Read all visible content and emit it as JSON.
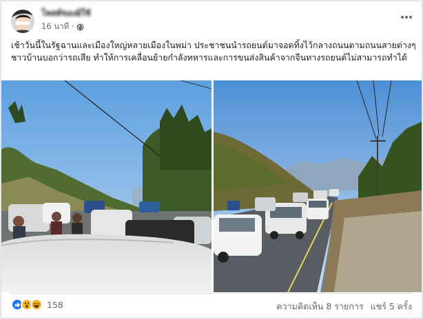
{
  "post": {
    "author_name": "โพสต์ของผู้ใช้",
    "timestamp": "16 นาที ·",
    "privacy_icon": "globe-icon",
    "more_icon": "more-options-icon",
    "caption": "เช้าวันนี้ในรัฐฉานและเมืองใหญ่หลายเมืองในพม่า ประชาชนนำรถยนต์มาจอดทิ้งไว้กลางถนนตามถนนสายต่างๆ ชาวบ้านบอกว่ารถเสีย ทำให้การเคลื่อนย้ายกำลังทหารและการขนส่งสินค้าจากจีนทางรถยนต์ไม่สามารถทำได้"
  },
  "photos": [
    {
      "name": "photo-cars-parked-left"
    },
    {
      "name": "photo-cars-road-right"
    }
  ],
  "footer": {
    "reaction_icons": [
      "like-icon",
      "wow-icon",
      "haha-icon"
    ],
    "reaction_count": "158",
    "comments": "ความคิดเห็น 8 รายการ",
    "shares": "แชร์ 5 ครั้ง"
  },
  "colors": {
    "text": "#1c1e21",
    "secondary_text": "#65676b",
    "like_blue": "#1877f2",
    "wow_yellow": "#f7b125"
  }
}
